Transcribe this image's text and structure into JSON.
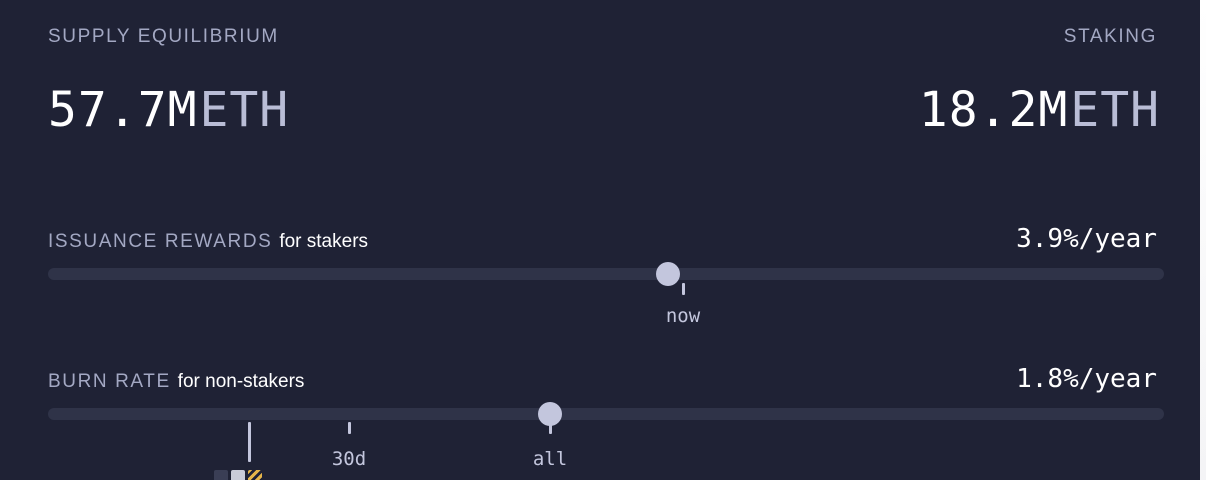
{
  "supply": {
    "label": "SUPPLY EQUILIBRIUM",
    "value": "57.7M",
    "unit": "ETH"
  },
  "staking": {
    "label": "STAKING",
    "value": "18.2M",
    "unit": "ETH"
  },
  "issuance": {
    "label": "ISSUANCE REWARDS",
    "sublabel": "for stakers",
    "rate": "3.9%/year",
    "slider_value": 0.556,
    "tick_label": "now"
  },
  "burn": {
    "label": "BURN RATE",
    "sublabel": "for non-stakers",
    "rate": "1.8%/year",
    "slider_value": 0.45,
    "tick_30d": "30d",
    "tick_all": "all"
  },
  "colors": {
    "background": "#1f2235",
    "track": "#2f3348",
    "thumb": "#c3c6dd",
    "muted_text": "#a3a8c3"
  }
}
